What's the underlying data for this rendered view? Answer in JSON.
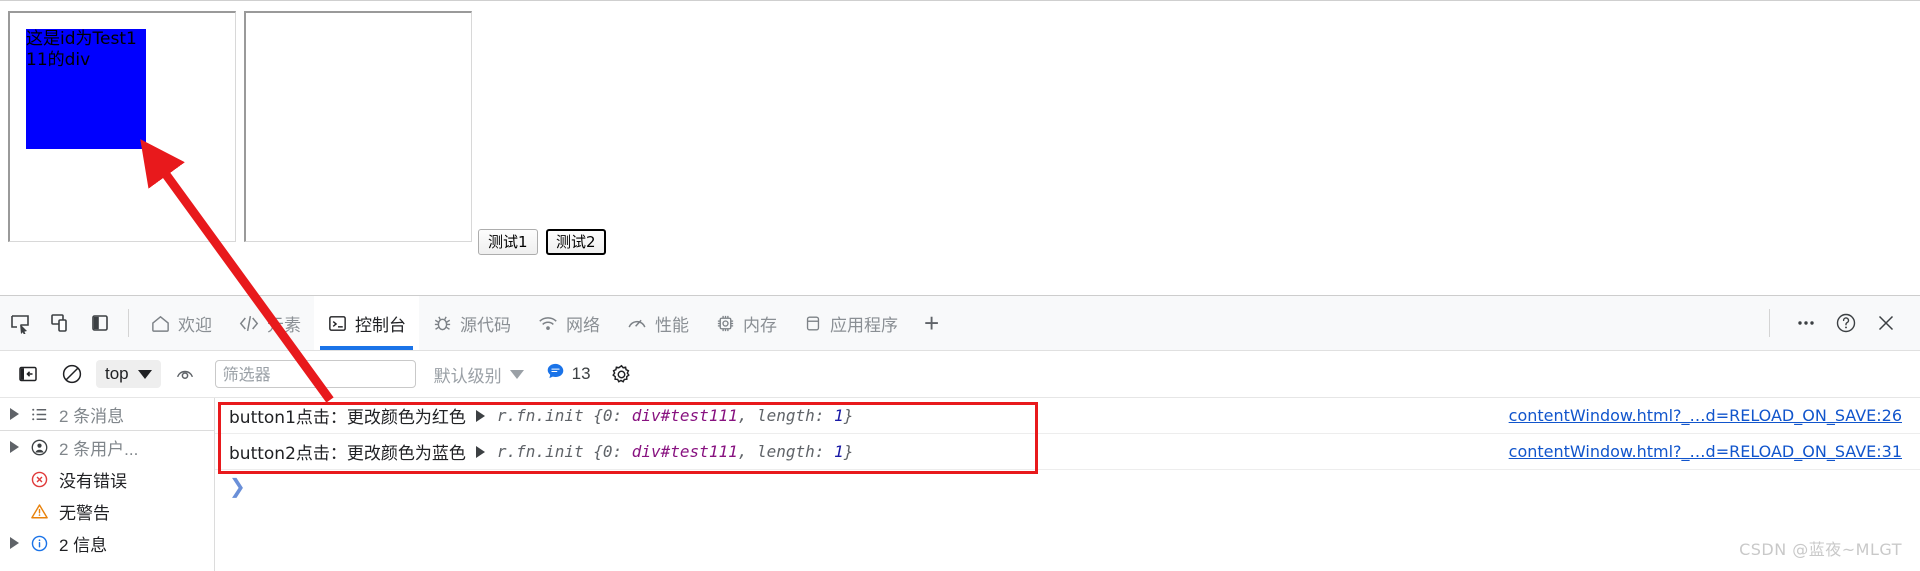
{
  "page": {
    "test_div_text": "这是id为Test111的div",
    "test_div_color": "#0000ff",
    "buttons": [
      {
        "label": "测试1",
        "focused": false
      },
      {
        "label": "测试2",
        "focused": true
      }
    ]
  },
  "devtools": {
    "left_icons": [
      {
        "name": "inspect-element-icon"
      },
      {
        "name": "device-toolbar-icon"
      },
      {
        "name": "dock-side-icon"
      }
    ],
    "tabs": [
      {
        "label": "欢迎",
        "icon": "home-icon",
        "active": false
      },
      {
        "label": "元素",
        "icon": "code-brackets-icon",
        "active": false
      },
      {
        "label": "控制台",
        "icon": "console-terminal-icon",
        "active": true
      },
      {
        "label": "源代码",
        "icon": "bug-icon",
        "active": false
      },
      {
        "label": "网络",
        "icon": "wifi-icon",
        "active": false
      },
      {
        "label": "性能",
        "icon": "gauge-icon",
        "active": false
      },
      {
        "label": "内存",
        "icon": "chip-icon",
        "active": false
      },
      {
        "label": "应用程序",
        "icon": "database-icon",
        "active": false
      }
    ],
    "add_tab_label": "+",
    "right_icons": [
      {
        "name": "more-options-icon",
        "glyph": "···"
      },
      {
        "name": "help-icon",
        "glyph": "?"
      },
      {
        "name": "close-devtools-icon",
        "glyph": "×"
      }
    ],
    "filterbar": {
      "sidebar_toggle_icon": "console-sidebar-toggle-icon",
      "clear_console_icon": "clear-console-icon",
      "context_value": "top",
      "live_expression_icon": "eye-icon",
      "filter_placeholder": "筛选器",
      "filter_value": "",
      "level_label": "默认级别",
      "message_badge_count": "13",
      "settings_icon": "gear-icon",
      "badge_color": "#1a73e8"
    },
    "sidebar": [
      {
        "label": "2 条消息",
        "icon": "list-icon",
        "expandable": true,
        "tone": "muted"
      },
      {
        "label": "2 条用户...",
        "icon": "user-message-icon",
        "expandable": true,
        "tone": "muted"
      },
      {
        "label": "没有错误",
        "icon": "error-circle-icon",
        "expandable": false,
        "tone": "dark"
      },
      {
        "label": "无警告",
        "icon": "warning-triangle-icon",
        "expandable": false,
        "tone": "dark"
      },
      {
        "label": "2 信息",
        "icon": "info-circle-icon",
        "expandable": true,
        "tone": "dark"
      }
    ],
    "console_rows": [
      {
        "text": "button1点击：更改颜色为红色",
        "object_prefix": "r.fn.init {0: ",
        "object_prop": "div#test111",
        "object_mid": ", length: ",
        "object_num": "1",
        "object_suffix": "}",
        "source": "contentWindow.html?_…d=RELOAD_ON_SAVE:26"
      },
      {
        "text": "button2点击：更改颜色为蓝色",
        "object_prefix": "r.fn.init {0: ",
        "object_prop": "div#test111",
        "object_mid": ", length: ",
        "object_num": "1",
        "object_suffix": "}",
        "source": "contentWindow.html?_…d=RELOAD_ON_SAVE:31"
      }
    ],
    "prompt_caret": "❯"
  },
  "annotation": {
    "highlight_color": "#e8191c",
    "arrow_color": "#e8191c"
  },
  "watermark": "CSDN @蓝夜~MLGT"
}
